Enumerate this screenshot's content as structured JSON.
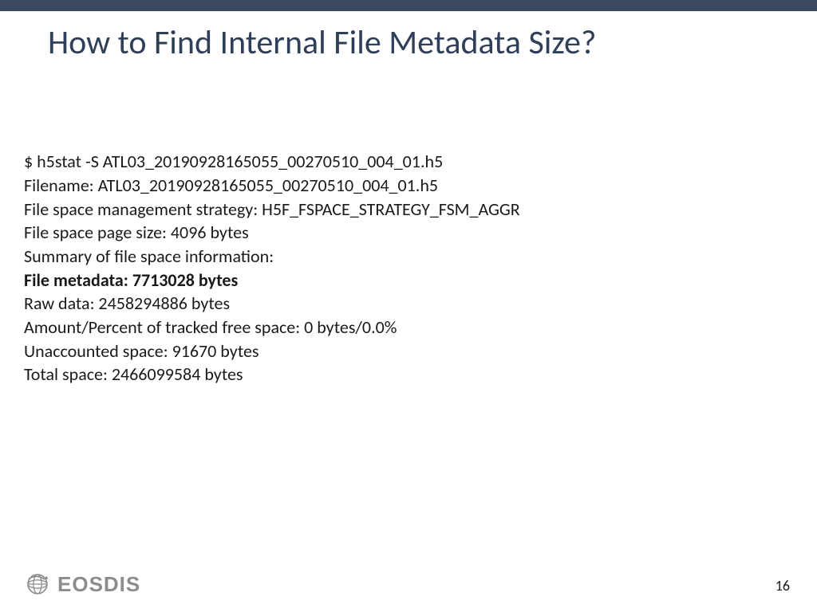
{
  "colors": {
    "bar": "#3a4a63",
    "title": "#2f3f57",
    "logo": "#8c8c8c"
  },
  "title": "How to Find Internal File Metadata Size?",
  "body": {
    "l0": "$ h5stat -S ATL03_20190928165055_00270510_004_01.h5",
    "l1": "Filename: ATL03_20190928165055_00270510_004_01.h5",
    "l2": "File space management strategy: H5F_FSPACE_STRATEGY_FSM_AGGR",
    "l3": "File space page size: 4096 bytes",
    "l4": "Summary of file space information:",
    "l5": "File metadata: 7713028 bytes",
    "l6": "Raw data: 2458294886 bytes",
    "l7": "Amount/Percent of tracked free space: 0 bytes/0.0%",
    "l8": "Unaccounted space: 91670 bytes",
    "l9": "Total space: 2466099584 bytes"
  },
  "footer": {
    "logo_text": "EOSDIS",
    "page_number": "16"
  }
}
